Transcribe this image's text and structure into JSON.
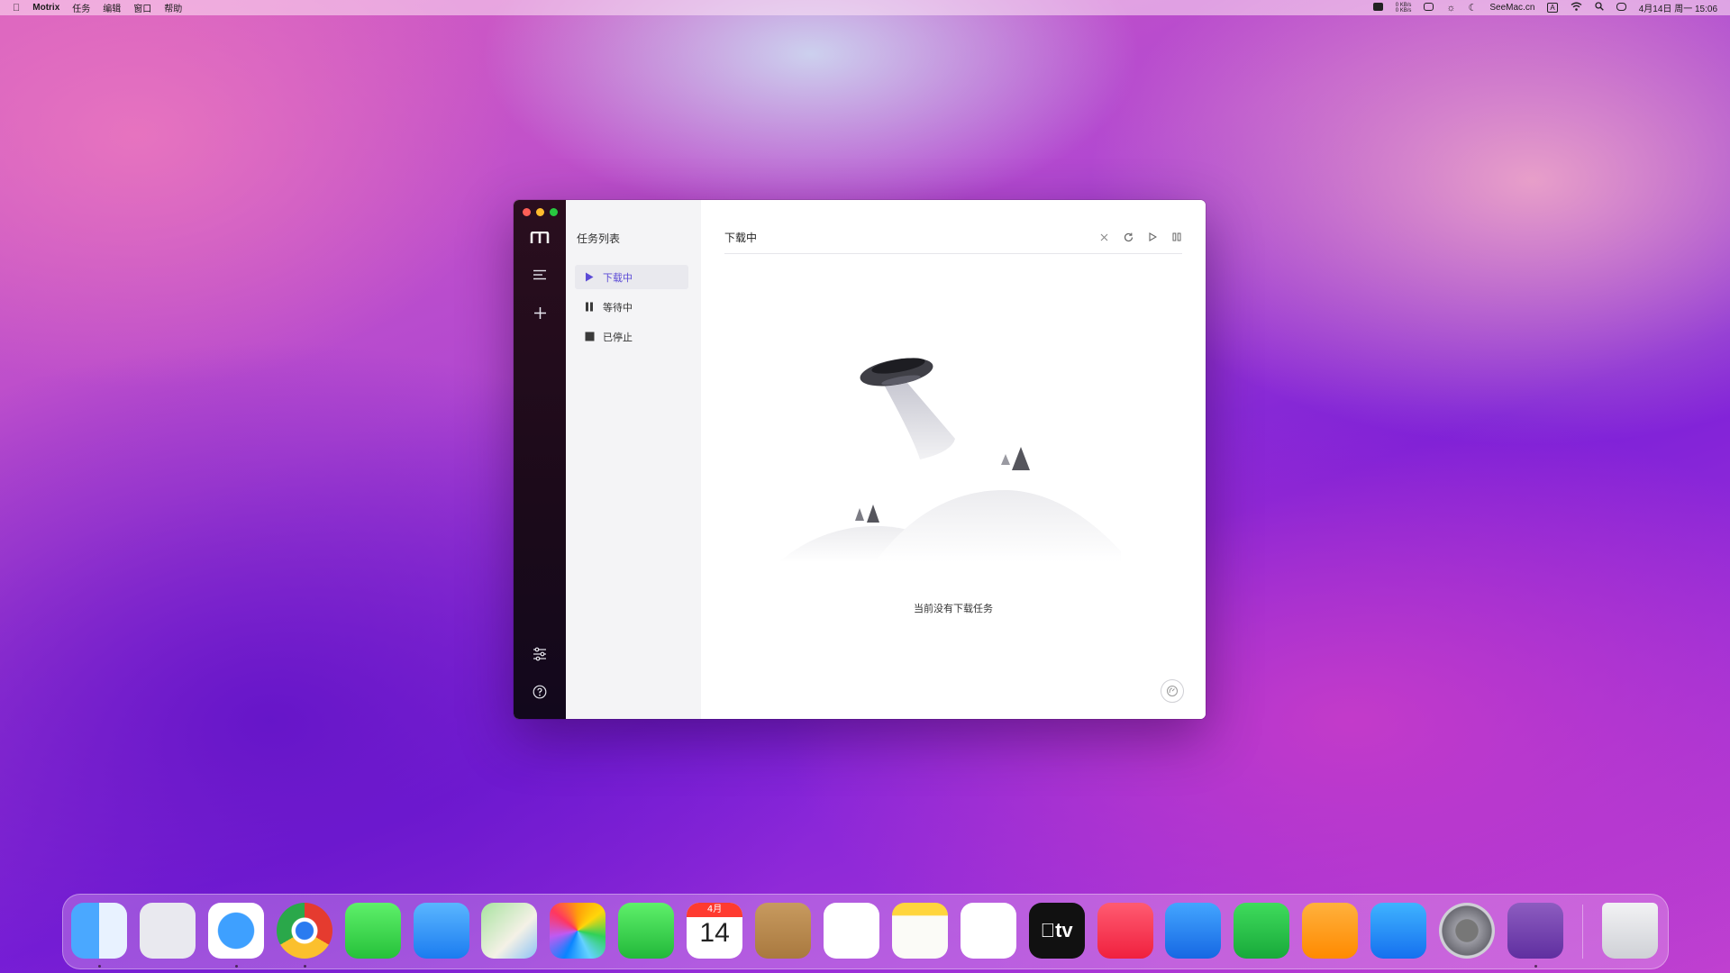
{
  "menubar": {
    "app_name": "Motrix",
    "menus": [
      "任务",
      "编辑",
      "窗口",
      "帮助"
    ],
    "speed_up": "0 KB/s",
    "speed_down": "0 KB/s",
    "site": "SeeMac.cn",
    "input_method": "A",
    "datetime": "4月14日 周一  15:06"
  },
  "window": {
    "sidebar_title": "任务列表",
    "sidebar_items": [
      {
        "label": "下载中",
        "icon": "play-icon",
        "active": true
      },
      {
        "label": "等待中",
        "icon": "pause-icon",
        "active": false
      },
      {
        "label": "已停止",
        "icon": "stop-icon",
        "active": false
      }
    ],
    "main_title": "下载中",
    "empty_message": "当前没有下载任务",
    "accent": "#5b4ad6"
  },
  "dock": {
    "apps": [
      {
        "name": "Finder",
        "running": true
      },
      {
        "name": "Launchpad",
        "running": false
      },
      {
        "name": "Safari",
        "running": true
      },
      {
        "name": "Chrome",
        "running": true
      },
      {
        "name": "Messages",
        "running": false
      },
      {
        "name": "Mail",
        "running": false
      },
      {
        "name": "Maps",
        "running": false
      },
      {
        "name": "Photos",
        "running": false
      },
      {
        "name": "FaceTime",
        "running": false
      },
      {
        "name": "Calendar",
        "running": false,
        "month": "4月",
        "day": "14"
      },
      {
        "name": "Contacts",
        "running": false
      },
      {
        "name": "Reminders",
        "running": false
      },
      {
        "name": "Notes",
        "running": false
      },
      {
        "name": "Freeform",
        "running": false
      },
      {
        "name": "TV",
        "running": false,
        "label": "tv"
      },
      {
        "name": "Music",
        "running": false
      },
      {
        "name": "Keynote",
        "running": false
      },
      {
        "name": "Numbers",
        "running": false
      },
      {
        "name": "Pages",
        "running": false
      },
      {
        "name": "App Store",
        "running": false
      },
      {
        "name": "System Settings",
        "running": false
      },
      {
        "name": "Motrix",
        "running": true
      },
      {
        "name": "Trash",
        "running": false
      }
    ]
  }
}
